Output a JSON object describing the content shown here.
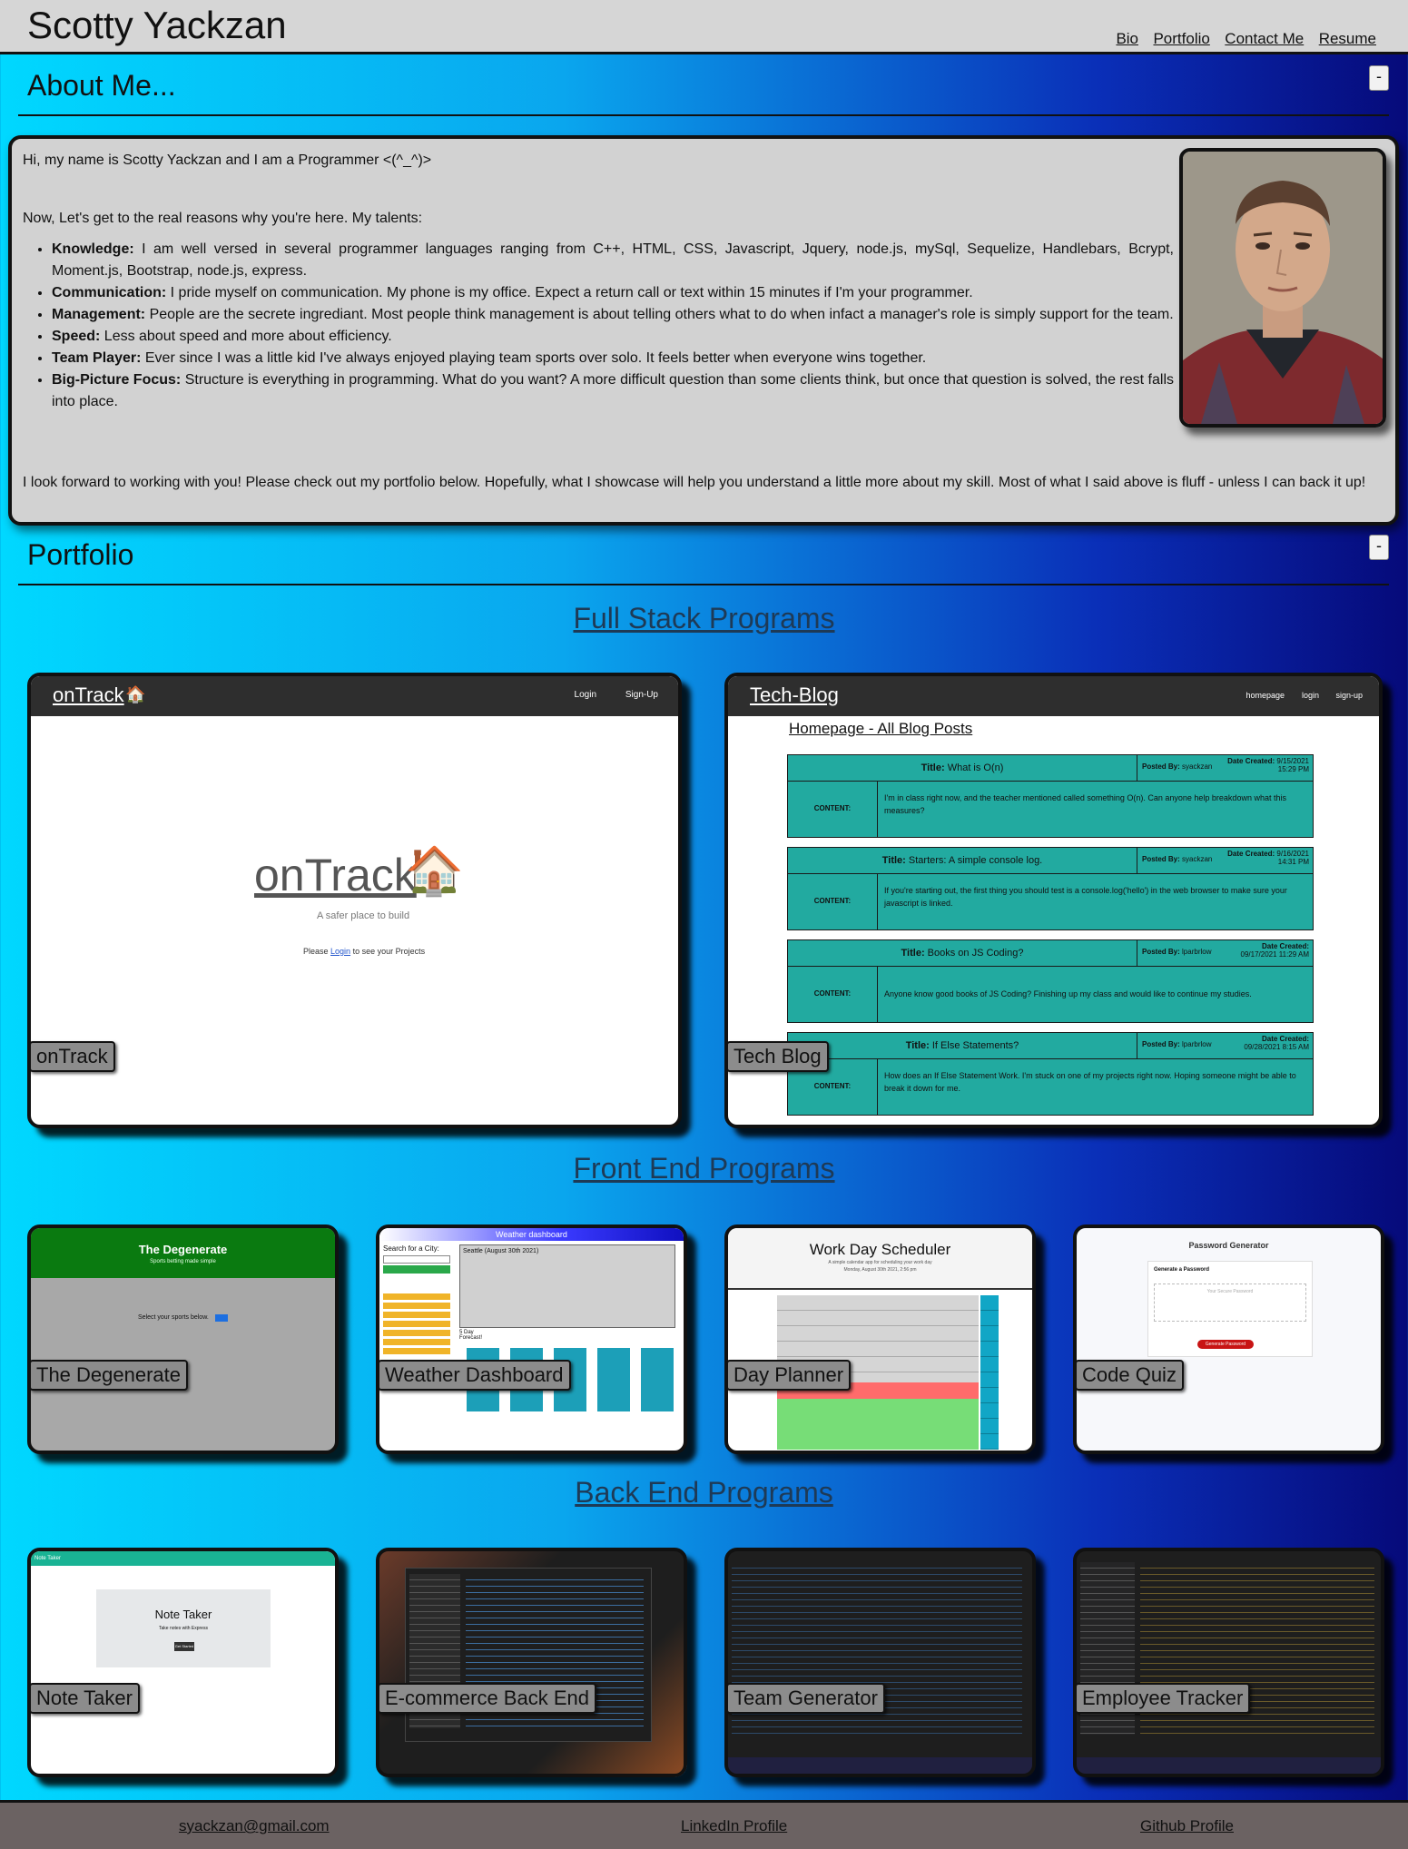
{
  "header": {
    "brand": "Scotty Yackzan",
    "nav": [
      "Bio",
      "Portfolio",
      "Contact Me",
      "Resume"
    ]
  },
  "about": {
    "title": "About Me...",
    "collapse_label": "-",
    "intro": "Hi, my name is Scotty Yackzan and I am a Programmer <(^_^)>",
    "lead": "Now, Let's get to the real reasons why you're here. My talents:",
    "talents": [
      {
        "name": "Knowledge:",
        "text": " I am well versed in several programmer languages ranging from C++, HTML, CSS, Javascript, Jquery, node.js, mySql, Sequelize, Handlebars, Bcrypt, Moment.js, Bootstrap, node.js, express."
      },
      {
        "name": "Communication:",
        "text": " I pride myself on communication. My phone is my office. Expect a return call or text within 15 minutes if I'm your programmer."
      },
      {
        "name": "Management:",
        "text": " People are the secrete ingrediant. Most people think management is about telling others what to do when infact a manager's role is simply support for the team."
      },
      {
        "name": "Speed:",
        "text": " Less about speed and more about efficiency."
      },
      {
        "name": "Team Player:",
        "text": " Ever since I was a little kid I've always enjoyed playing team sports over solo. It feels better when everyone wins together."
      },
      {
        "name": "Big-Picture Focus:",
        "text": " Structure is everything in programming. What do you want? A more difficult question than some clients think, but once that question is solved, the rest falls into place."
      }
    ],
    "closing": "I look forward to working with you! Please check out my portfolio below. Hopefully, what I showcase will help you understand a little more about my skill. Most of what I said above is fluff - unless I can back it up!"
  },
  "portfolio": {
    "title": "Portfolio",
    "collapse_label": "-",
    "full_stack_title": "Full Stack Programs",
    "front_end_title": "Front End Programs",
    "back_end_title": "Back End Programs",
    "full_stack": [
      {
        "label": "onTrack"
      },
      {
        "label": "Tech Blog"
      }
    ],
    "front_end": [
      {
        "label": "The Degenerate"
      },
      {
        "label": "Weather Dashboard"
      },
      {
        "label": "Day Planner"
      },
      {
        "label": "Code Quiz"
      }
    ],
    "back_end": [
      {
        "label": "Note Taker"
      },
      {
        "label": "E-commerce Back End"
      },
      {
        "label": "Team Generator"
      },
      {
        "label": "Employee Tracker"
      }
    ]
  },
  "previews": {
    "ontrack": {
      "brand": "onTrack",
      "nav": [
        "Login",
        "Sign-Up"
      ],
      "logo": "onTrack",
      "tagline": "A safer place to build",
      "prompt_pre": "Please ",
      "prompt_link": "Login",
      "prompt_post": " to see your Projects"
    },
    "techblog": {
      "brand": "Tech-Blog",
      "nav": [
        "homepage",
        "login",
        "sign-up"
      ],
      "heading": "Homepage - All Blog Posts",
      "posts": [
        {
          "title": "What is O(n)",
          "author": "syackzan",
          "date": "9/15/2021",
          "time": "15:29 PM",
          "content": "I'm in class right now, and the teacher mentioned called something O(n). Can anyone help breakdown what this measures?"
        },
        {
          "title": "Starters: A simple console log.",
          "author": "syackzan",
          "date": "9/16/2021",
          "time": "14:31 PM",
          "content": "If you're starting out, the first thing you should test is a console.log('hello') in the web browser to make sure your javascript is linked."
        },
        {
          "title": "Books on JS Coding?",
          "author": "lparbrlow",
          "date": "09/17/2021",
          "time": "11:29 AM",
          "content": "Anyone know good books of JS Coding? Finishing up my class and would like to continue my studies."
        },
        {
          "title": "If Else Statements?",
          "author": "lparbrlow",
          "date": "09/28/2021",
          "time": "8:15 AM",
          "content": "How does an If Else Statement Work. I'm stuck on one of my projects right now. Hoping someone might be able to break it down for me."
        }
      ],
      "title_label": "Title:",
      "posted_label": "Posted By:",
      "date_label": "Date Created:",
      "content_label": "CONTENT:"
    },
    "degenerate": {
      "title": "The Degenerate",
      "subtitle": "Sports betting made simple",
      "prompt": "Select your sports below."
    },
    "weather": {
      "title": "Weather dashboard",
      "search_label": "Search for a City:",
      "city": "Seattle (August 30th 2021)",
      "forecast": "5 Day Forecast!"
    },
    "scheduler": {
      "title": "Work Day Scheduler",
      "subtitle": "A simple calendar app for scheduling your work day",
      "date": "Monday, August 30th 2021, 2:56 pm"
    },
    "password": {
      "title": "Password Generator",
      "card_title": "Generate a Password",
      "placeholder": "Your Secure Password",
      "button": "Generate Password"
    },
    "notetaker": {
      "bar": "Note Taker",
      "title": "Note Taker",
      "subtitle": "Take notes with Express",
      "button": "Get Started"
    }
  },
  "footer": {
    "email": "syackzan@gmail.com",
    "linkedin": "LinkedIn Profile",
    "github": "Github Profile"
  }
}
